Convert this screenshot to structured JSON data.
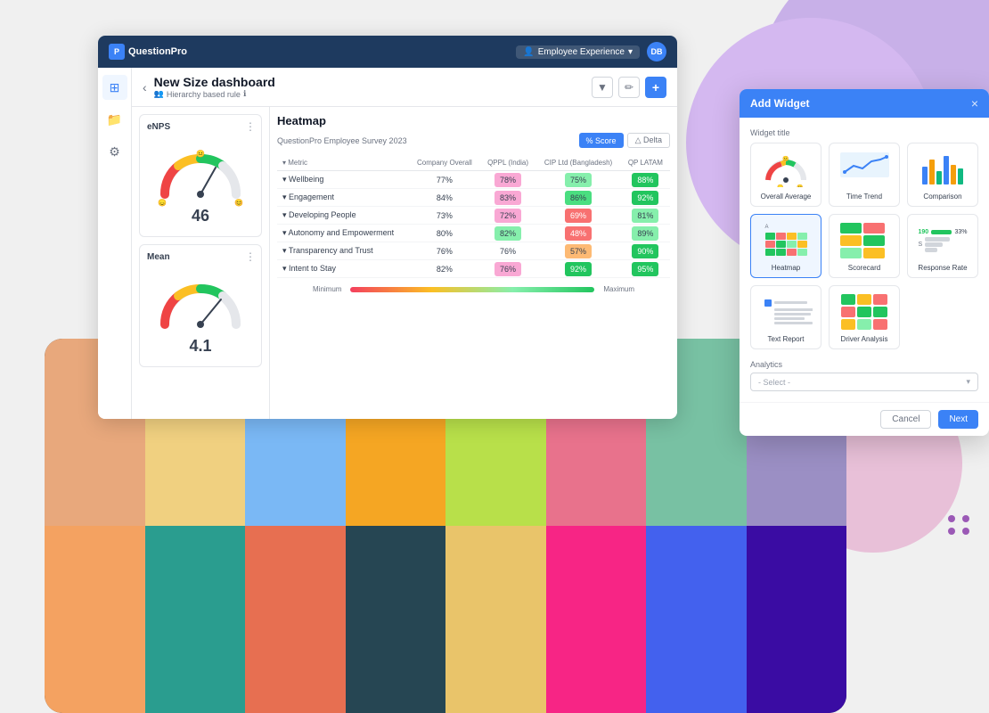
{
  "app": {
    "logo_text": "QuestionPro",
    "topbar": {
      "product_label": "Employee Experience",
      "avatar_initials": "DB"
    },
    "dashboard_title": "New Size dashboard",
    "hierarchy_label": "Hierarchy based rule",
    "header_actions": {
      "filter_icon": "▼",
      "edit_icon": "✏",
      "add_icon": "+"
    }
  },
  "sidebar": {
    "icons": [
      "⊞",
      "📁",
      "⚙"
    ]
  },
  "widgets": {
    "enps": {
      "title": "eNPS",
      "value": "46"
    },
    "mean": {
      "title": "Mean",
      "value": "4.1"
    }
  },
  "heatmap": {
    "title": "Heatmap",
    "survey_label": "QuestionPro Employee Survey 2023",
    "btn_score": "% Score",
    "btn_delta": "△ Delta",
    "columns": [
      "Metric",
      "Company Overall",
      "QPPL (India)",
      "CIP Ltd (Bangladesh)",
      "QP LATAM"
    ],
    "rows": [
      {
        "metric": "Wellbeing",
        "company_overall": "77%",
        "qppl": "78%",
        "cip": "75%",
        "qp_latam": "88%",
        "colors": [
          "plain",
          "pink",
          "green-light",
          "green-dark"
        ]
      },
      {
        "metric": "Engagement",
        "company_overall": "84%",
        "qppl": "83%",
        "cip": "86%",
        "qp_latam": "92%",
        "colors": [
          "plain",
          "pink",
          "green",
          "green-dark"
        ]
      },
      {
        "metric": "Developing People",
        "company_overall": "73%",
        "qppl": "72%",
        "cip": "69%",
        "qp_latam": "81%",
        "colors": [
          "plain",
          "pink",
          "red",
          "green-light"
        ]
      },
      {
        "metric": "Autonomy and Empowerment",
        "company_overall": "80%",
        "qppl": "82%",
        "cip": "48%",
        "qp_latam": "89%",
        "colors": [
          "plain",
          "green-light",
          "red",
          "green-light"
        ]
      },
      {
        "metric": "Transparency and Trust",
        "company_overall": "76%",
        "qppl": "76%",
        "cip": "57%",
        "qp_latam": "90%",
        "colors": [
          "plain",
          "plain",
          "orange",
          "green-dark"
        ]
      },
      {
        "metric": "Intent to Stay",
        "company_overall": "82%",
        "qppl": "76%",
        "cip": "92%",
        "qp_latam": "95%",
        "colors": [
          "plain",
          "pink",
          "green-dark",
          "green-dark"
        ]
      }
    ],
    "legend": {
      "min_label": "Minimum",
      "max_label": "Maximum"
    }
  },
  "add_widget_modal": {
    "title": "Add Widget",
    "close_icon": "×",
    "widget_title_label": "Widget title",
    "widgets": [
      {
        "name": "Overall Average",
        "type": "gauge"
      },
      {
        "name": "Time Trend",
        "type": "trend"
      },
      {
        "name": "Comparison",
        "type": "bars"
      },
      {
        "name": "Heatmap",
        "type": "heatmap"
      },
      {
        "name": "Scorecard",
        "type": "scorecard"
      },
      {
        "name": "Response Rate",
        "type": "response"
      },
      {
        "name": "Text Report",
        "type": "text"
      },
      {
        "name": "Driver Analysis",
        "type": "driver"
      }
    ],
    "analytics_label": "Analytics",
    "analytics_placeholder": "- Select -",
    "btn_cancel": "Cancel",
    "btn_next": "Next"
  },
  "dot_grid": {
    "dots": 4
  },
  "face_colors": [
    "#e8a87c",
    "#f0d080",
    "#7ab8f5",
    "#f5a623",
    "#b8e04a",
    "#e8728c",
    "#78c1a3",
    "#9b8fc4",
    "#f4a261",
    "#2a9d8f",
    "#e76f51",
    "#264653",
    "#e9c46a",
    "#f72585",
    "#4361ee",
    "#3a0ca3"
  ]
}
